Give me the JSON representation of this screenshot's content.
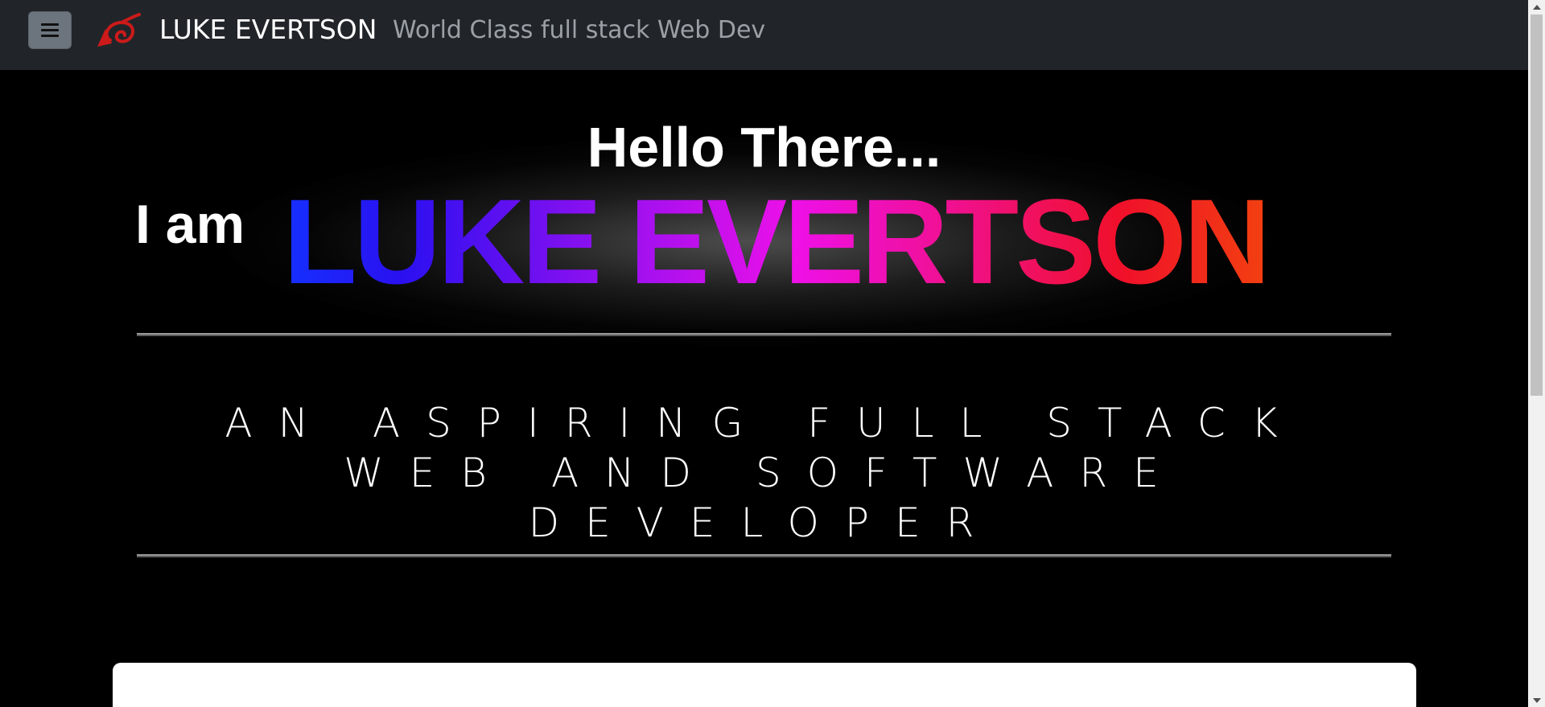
{
  "navbar": {
    "menu_icon": "hamburger-menu-icon",
    "logo_icon": "red-swirl-leaf-logo",
    "brand": "LUKE EVERTSON",
    "tagline": "World Class full stack Web Dev"
  },
  "hero": {
    "greeting": "Hello There...",
    "intro": "I am",
    "name": "LUKE EVERTSON",
    "subtitle": "AN ASPIRING FULL STACK WEB AND SOFTWARE DEVELOPER"
  },
  "colors": {
    "navbar_bg": "#212529",
    "page_bg": "#000000",
    "brand_text": "#ffffff",
    "tagline_text": "#9aa0a6",
    "logo_red": "#cc1a1a",
    "name_gradient": [
      "#1530ff",
      "#9d10f0",
      "#ee10e8",
      "#f01090",
      "#f0102a",
      "#f24010"
    ]
  }
}
